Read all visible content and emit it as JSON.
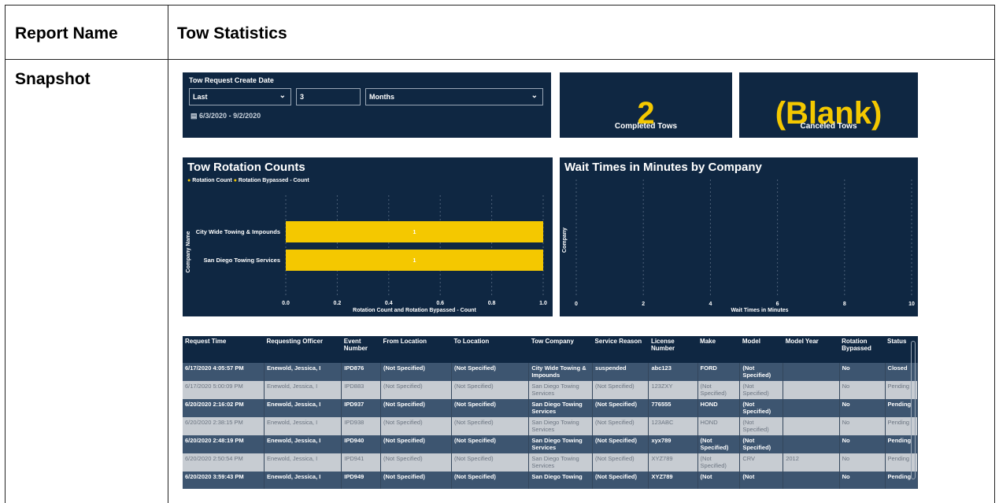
{
  "report_label": "Report Name",
  "report_name": "Tow Statistics",
  "snapshot_label": "Snapshot",
  "filter": {
    "title": "Tow Request Create Date",
    "period": "Last",
    "count": "3",
    "unit": "Months",
    "range": "6/3/2020 - 9/2/2020"
  },
  "kpis": {
    "completed_value": "2",
    "completed_label": "Completed Tows",
    "canceled_value": "(Blank)",
    "canceled_label": "Canceled Tows"
  },
  "colors": {
    "panel": "#0f2742",
    "accent": "#f4c800"
  },
  "chart_data": [
    {
      "type": "bar",
      "title": "Tow Rotation Counts",
      "legend": [
        "Rotation Count",
        "Rotation Bypassed - Count"
      ],
      "categories": [
        "City Wide Towing & Impounds",
        "San Diego Towing Services"
      ],
      "values": [
        1,
        1
      ],
      "data_labels": [
        "1",
        "1"
      ],
      "xlabel": "Rotation Count and Rotation Bypassed - Count",
      "ylabel": "Company Name",
      "xlim": [
        0,
        1
      ],
      "ticks": [
        "0.0",
        "0.2",
        "0.4",
        "0.6",
        "0.8",
        "1.0"
      ]
    },
    {
      "type": "bar",
      "title": "Wait Times in Minutes by Company",
      "categories": [],
      "values": [],
      "xlabel": "Wait Times in Minutes",
      "ylabel": "Company",
      "xlim": [
        0,
        10
      ],
      "ticks": [
        "0",
        "2",
        "4",
        "6",
        "8",
        "10"
      ]
    }
  ],
  "table": {
    "columns": [
      "Request Time",
      "Requesting Officer",
      "Event Number",
      "From Location",
      "To Location",
      "Tow Company",
      "Service Reason",
      "License Number",
      "Make",
      "Model",
      "Model Year",
      "Rotation Bypassed",
      "Status"
    ],
    "rows": [
      [
        "6/17/2020 4:05:57 PM",
        "Enewold, Jessica, I",
        "IPD876",
        "(Not Specified)",
        "(Not Specified)",
        "City Wide Towing & Impounds",
        "suspended",
        "abc123",
        "FORD",
        "(Not Specified)",
        "",
        "No",
        "Closed"
      ],
      [
        "6/17/2020 5:00:09 PM",
        "Enewold, Jessica, I",
        "IPD883",
        "(Not Specified)",
        "(Not Specified)",
        "San Diego Towing Services",
        "(Not Specified)",
        "123ZXY",
        "(Not Specified)",
        "(Not Specified)",
        "",
        "No",
        "Pending"
      ],
      [
        "6/20/2020 2:16:02 PM",
        "Enewold, Jessica, I",
        "IPD937",
        "(Not Specified)",
        "(Not Specified)",
        "San Diego Towing Services",
        "(Not Specified)",
        "776555",
        "HOND",
        "(Not Specified)",
        "",
        "No",
        "Pending"
      ],
      [
        "6/20/2020 2:38:15 PM",
        "Enewold, Jessica, I",
        "IPD938",
        "(Not Specified)",
        "(Not Specified)",
        "San Diego Towing Services",
        "(Not Specified)",
        "123ABC",
        "HOND",
        "(Not Specified)",
        "",
        "No",
        "Pending"
      ],
      [
        "6/20/2020 2:48:19 PM",
        "Enewold, Jessica, I",
        "IPD940",
        "(Not Specified)",
        "(Not Specified)",
        "San Diego Towing Services",
        "(Not Specified)",
        "xyx789",
        "(Not Specified)",
        "(Not Specified)",
        "",
        "No",
        "Pending"
      ],
      [
        "6/20/2020 2:50:54 PM",
        "Enewold, Jessica, I",
        "IPD941",
        "(Not Specified)",
        "(Not Specified)",
        "San Diego Towing Services",
        "(Not Specified)",
        "XYZ789",
        "(Not Specified)",
        "CRV",
        "2012",
        "No",
        "Pending"
      ],
      [
        "6/20/2020 3:59:43 PM",
        "Enewold, Jessica, I",
        "IPD949",
        "(Not Specified)",
        "(Not Specified)",
        "San Diego Towing",
        "(Not Specified)",
        "XYZ789",
        "(Not",
        "(Not",
        "",
        "No",
        "Pending"
      ]
    ]
  }
}
